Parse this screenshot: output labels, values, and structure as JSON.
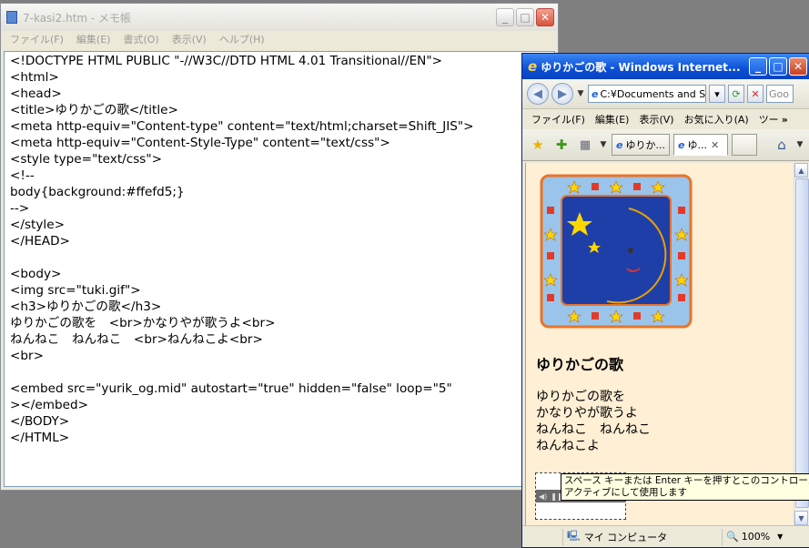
{
  "notepad": {
    "title": "7-kasi2.htm - メモ帳",
    "menu": [
      "ファイル(F)",
      "編集(E)",
      "書式(O)",
      "表示(V)",
      "ヘルプ(H)"
    ],
    "lines": [
      "<!DOCTYPE HTML PUBLIC \"-//W3C//DTD HTML 4.01 Transitional//EN\">",
      "<html>",
      "<head>",
      "<title>ゆりかごの歌</title>",
      "<meta http-equiv=\"Content-type\" content=\"text/html;charset=Shift_JIS\">",
      "<meta http-equiv=\"Content-Style-Type\" content=\"text/css\">",
      "<style type=\"text/css\">",
      "<!--",
      "body{background:#ffefd5;}",
      "-->",
      "</style>",
      "</HEAD>",
      "",
      "<body>",
      "<img src=\"tuki.gif\">",
      "<h3>ゆりかごの歌</h3>",
      "ゆりかごの歌を　<br>かなりやが歌うよ<br>",
      "ねんねこ　ねんねこ　<br>ねんねこよ<br>",
      "<br>",
      "",
      "<embed src=\"yurik_og.mid\" autostart=\"true\" hidden=\"false\" loop=\"5\"",
      "></embed>",
      "</BODY>",
      "</HTML>"
    ]
  },
  "ie": {
    "title": "ゆりかごの歌 - Windows Internet...",
    "address": "C:¥Documents and S",
    "search_stub": "Goo",
    "menu": [
      "ファイル(F)",
      "編集(E)",
      "表示(V)",
      "お気に入り(A)",
      "ツー"
    ],
    "more": "»",
    "tabs": [
      {
        "label": "ゆりか..."
      },
      {
        "label": "ゆ..."
      }
    ],
    "page": {
      "heading": "ゆりかごの歌",
      "lines": [
        "ゆりかごの歌を",
        "かなりやが歌うよ",
        "ねんねこ　ねんねこ",
        "ねんねこよ"
      ]
    },
    "tooltip": "スペース キーまたは Enter キーを押すとこのコントロールをアクティブにして使用します",
    "status": {
      "zone": "マイ コンピュータ",
      "zoom": "100%"
    }
  },
  "colors": {
    "page_bg": "#ffefd5",
    "ie_title": "#0a4fd6",
    "moon": "#ffd700",
    "sky": "#1f3fa8"
  }
}
